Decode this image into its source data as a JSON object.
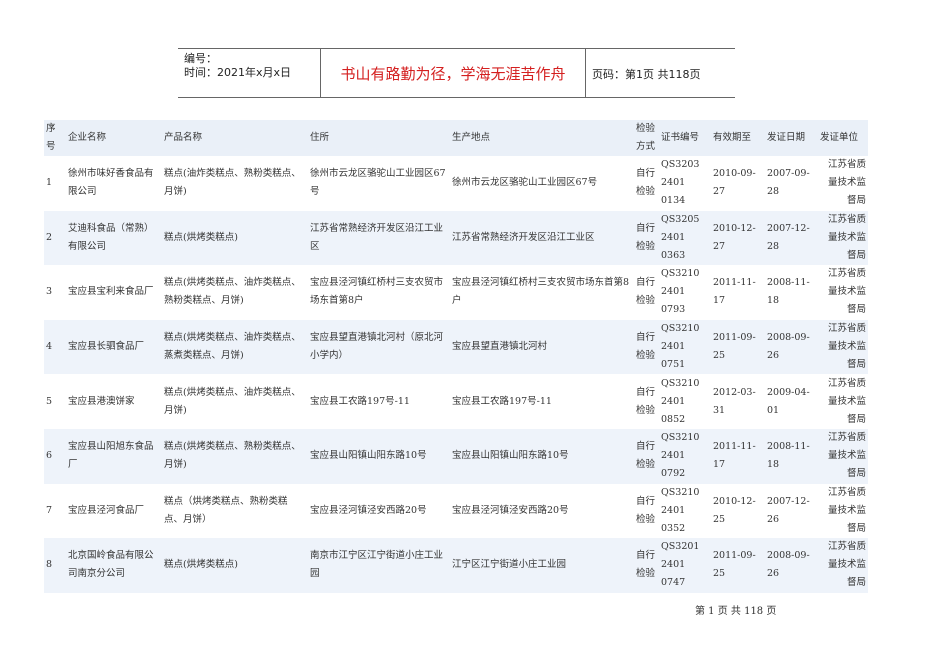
{
  "header": {
    "number_label": "编号：",
    "time_label": "时间：2021年x月x日",
    "motto": "书山有路勤为径，学海无涯苦作舟",
    "page_label": "页码：第1页  共118页"
  },
  "table": {
    "columns": [
      "序号",
      "企业名称",
      "产品名称",
      "住所",
      "生产地点",
      "检验方式",
      "证书编号",
      "有效期至",
      "发证日期",
      "发证单位"
    ],
    "rows": [
      {
        "no": "1",
        "company": "徐州市味好香食品有限公司",
        "product": "糕点(油炸类糕点、熟粉类糕点、月饼)",
        "address": "徐州市云龙区骆驼山工业园区67号",
        "site": "徐州市云龙区骆驼山工业园区67号",
        "inspection": "自行检验",
        "cert": "QS3203 2401 0134",
        "valid": "2010-09-27",
        "issued": "2007-09-28",
        "authority": "江苏省质量技术监督局"
      },
      {
        "no": "2",
        "company": "艾迪科食品（常熟）有限公司",
        "product": "糕点(烘烤类糕点)",
        "address": "江苏省常熟经济开发区沿江工业区",
        "site": "江苏省常熟经济开发区沿江工业区",
        "inspection": "自行检验",
        "cert": "QS3205 2401 0363",
        "valid": "2010-12-27",
        "issued": "2007-12-28",
        "authority": "江苏省质量技术监督局"
      },
      {
        "no": "3",
        "company": "宝应县宝利来食品厂",
        "product": "糕点(烘烤类糕点、油炸类糕点、熟粉类糕点、月饼)",
        "address": "宝应县泾河镇红桥村三支农贸市场东首第8户",
        "site": "宝应县泾河镇红桥村三支农贸市场东首第8户",
        "inspection": "自行检验",
        "cert": "QS3210 2401 0793",
        "valid": "2011-11-17",
        "issued": "2008-11-18",
        "authority": "江苏省质量技术监督局"
      },
      {
        "no": "4",
        "company": "宝应县长驷食品厂",
        "product": "糕点(烘烤类糕点、油炸类糕点、蒸煮类糕点、月饼)",
        "address": "宝应县望直港镇北河村（原北河小学内）",
        "site": "宝应县望直港镇北河村",
        "inspection": "自行检验",
        "cert": "QS3210 2401 0751",
        "valid": "2011-09-25",
        "issued": "2008-09-26",
        "authority": "江苏省质量技术监督局"
      },
      {
        "no": "5",
        "company": "宝应县港澳饼家",
        "product": "糕点(烘烤类糕点、油炸类糕点、月饼)",
        "address": "宝应县工农路197号-11",
        "site": "宝应县工农路197号-11",
        "inspection": "自行检验",
        "cert": "QS3210 2401 0852",
        "valid": "2012-03-31",
        "issued": "2009-04-01",
        "authority": "江苏省质量技术监督局"
      },
      {
        "no": "6",
        "company": "宝应县山阳旭东食品厂",
        "product": "糕点(烘烤类糕点、熟粉类糕点、月饼)",
        "address": "宝应县山阳镇山阳东路10号",
        "site": "宝应县山阳镇山阳东路10号",
        "inspection": "自行检验",
        "cert": "QS3210 2401 0792",
        "valid": "2011-11-17",
        "issued": "2008-11-18",
        "authority": "江苏省质量技术监督局"
      },
      {
        "no": "7",
        "company": "宝应县泾河食品厂",
        "product": "糕点（烘烤类糕点、熟粉类糕点、月饼）",
        "address": "宝应县泾河镇泾安西路20号",
        "site": "宝应县泾河镇泾安西路20号",
        "inspection": "自行检验",
        "cert": "QS3210 2401 0352",
        "valid": "2010-12-25",
        "issued": "2007-12-26",
        "authority": "江苏省质量技术监督局"
      },
      {
        "no": "8",
        "company": "北京国岭食品有限公司南京分公司",
        "product": "糕点(烘烤类糕点)",
        "address": "南京市江宁区江宁街道小庄工业园",
        "site": "江宁区江宁街道小庄工业园",
        "inspection": "自行检验",
        "cert": "QS3201 2401 0747",
        "valid": "2011-09-25",
        "issued": "2008-09-26",
        "authority": "江苏省质量技术监督局"
      }
    ]
  },
  "footer": {
    "page_text": "第 1 页 共 118 页"
  }
}
